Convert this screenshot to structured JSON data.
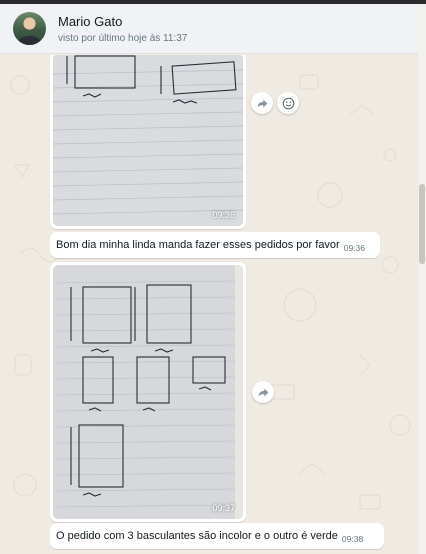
{
  "contact": {
    "name": "Mario Gato",
    "status": "visto por último hoje às 11:37"
  },
  "messages": [
    {
      "type": "image",
      "time": "09:36"
    },
    {
      "type": "text",
      "text": "Bom dia minha linda manda fazer esses pedidos por favor",
      "time": "09:36"
    },
    {
      "type": "image",
      "time": "09:37"
    },
    {
      "type": "text",
      "text": "O pedido com 3 basculantes são incolor  e o outro é verde",
      "time": "09:38"
    }
  ],
  "icons": {
    "forward": "forward-icon",
    "emoji": "emoji-icon"
  },
  "colors": {
    "chat_background": "#efeae2",
    "header_background": "#f0f2f5",
    "bubble": "#ffffff",
    "meta_text": "#667781"
  }
}
